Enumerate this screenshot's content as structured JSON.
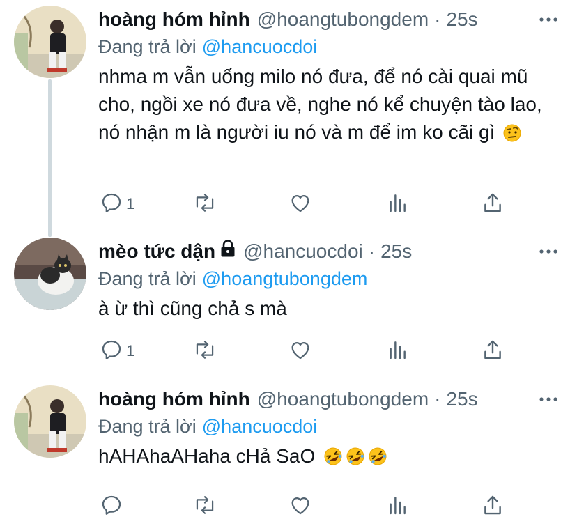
{
  "tweets": [
    {
      "name": "hoàng hóm hỉnh",
      "handle": "@hoangtubongdem",
      "separator": "·",
      "time": "25s",
      "replying_label": "Đang trả lời",
      "replying_to": "@hancuocdoi",
      "text": "nhma m vẫn uống milo nó đưa, để nó cài quai mũ cho, ngồi xe nó đưa về, nghe nó kể chuyện tào lao, nó nhận m là người iu nó và m để im ko cãi gì",
      "emojis": [
        "raised-eyebrow-emoji"
      ],
      "reply_count": "1",
      "protected": false
    },
    {
      "name": "mèo tức dận",
      "handle": "@hancuocdoi",
      "separator": "·",
      "time": "25s",
      "replying_label": "Đang trả lời",
      "replying_to": "@hoangtubongdem",
      "text": "à ừ thì cũng chả s mà",
      "emojis": [],
      "reply_count": "1",
      "protected": true
    },
    {
      "name": "hoàng hóm hỉnh",
      "handle": "@hoangtubongdem",
      "separator": "·",
      "time": "25s",
      "replying_label": "Đang trả lời",
      "replying_to": "@hancuocdoi",
      "text": "hAHAhaAHaha cHả SaO",
      "emojis": [
        "rofl-emoji",
        "rofl-emoji",
        "rofl-emoji"
      ],
      "reply_count": "",
      "protected": false
    }
  ],
  "colors": {
    "text": "#0f1419",
    "secondary": "#536471",
    "link": "#1d9bf0",
    "thread_line": "#cfd9de"
  },
  "icons": [
    "reply-icon",
    "retweet-icon",
    "like-icon",
    "views-icon",
    "share-icon",
    "more-icon",
    "lock-icon"
  ]
}
